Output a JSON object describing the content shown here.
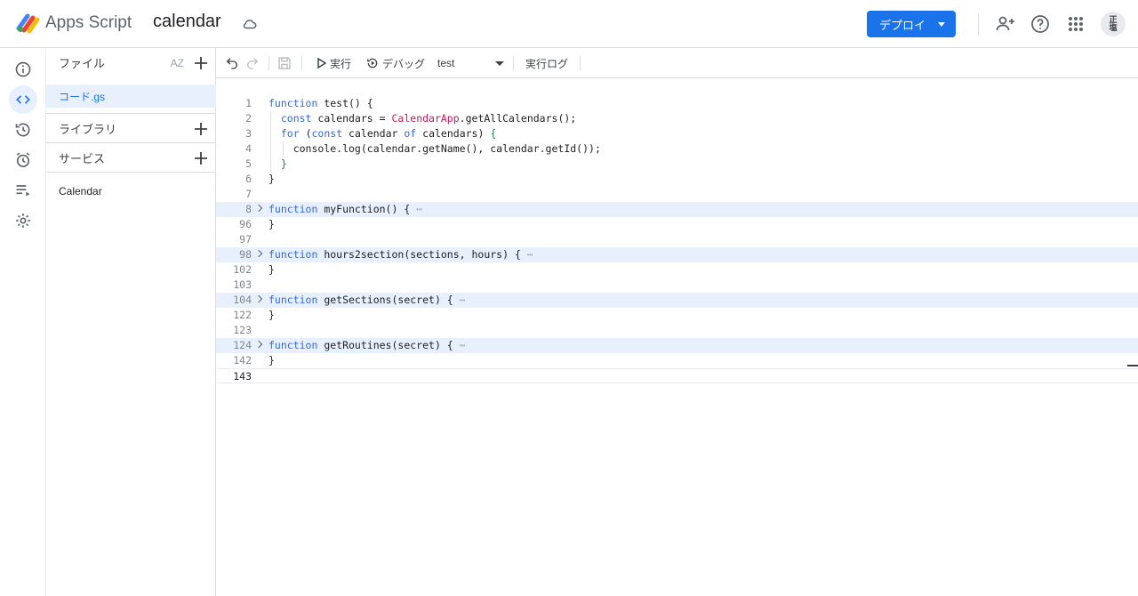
{
  "header": {
    "product_name": "Apps Script",
    "project_name": "calendar",
    "deploy_label": "デプロイ",
    "avatar_line1": "正",
    "avatar_line2": "塩"
  },
  "rail": {
    "items": [
      "overview",
      "editor",
      "executions",
      "triggers",
      "project-settings-logs",
      "settings"
    ],
    "active": "editor"
  },
  "files_panel": {
    "files_title": "ファイル",
    "sort_label": "AZ",
    "files": [
      "コード.gs"
    ],
    "libraries_title": "ライブラリ",
    "services_title": "サービス",
    "services": [
      "Calendar"
    ]
  },
  "toolbar": {
    "run_label": "実行",
    "debug_label": "デバッグ",
    "function_select": "test",
    "log_label": "実行ログ"
  },
  "code": {
    "lines": [
      {
        "n": "1",
        "html": "<span class=\"kw\">function</span> test() {"
      },
      {
        "n": "2",
        "html": "  <span class=\"kw\">const</span> calendars = <span class=\"cls\">CalendarApp</span>.getAllCalendars();"
      },
      {
        "n": "3",
        "html": "  <span class=\"kw\">for</span> (<span class=\"kw\">const</span> calendar <span class=\"kw\">of</span> calendars) <span class=\"punc\">{</span>"
      },
      {
        "n": "4",
        "html": "    console.log(calendar.getName(), calendar.getId());"
      },
      {
        "n": "5",
        "html": "  <span class=\"punc\">}</span>"
      },
      {
        "n": "6",
        "html": "}"
      },
      {
        "n": "7",
        "html": ""
      },
      {
        "n": "8",
        "html": "<span class=\"kw\">function</span> myFunction() { <span class=\"ell\">⋯</span>",
        "folded": true
      },
      {
        "n": "96",
        "html": "}"
      },
      {
        "n": "97",
        "html": ""
      },
      {
        "n": "98",
        "html": "<span class=\"kw\">function</span> hours2section(sections, hours) { <span class=\"ell\">⋯</span>",
        "folded": true
      },
      {
        "n": "102",
        "html": "}"
      },
      {
        "n": "103",
        "html": ""
      },
      {
        "n": "104",
        "html": "<span class=\"kw\">function</span> getSections(secret) { <span class=\"ell\">⋯</span>",
        "folded": true
      },
      {
        "n": "122",
        "html": "}"
      },
      {
        "n": "123",
        "html": ""
      },
      {
        "n": "124",
        "html": "<span class=\"kw\">function</span> getRoutines(secret) { <span class=\"ell\">⋯</span>",
        "folded": true
      },
      {
        "n": "142",
        "html": "}"
      },
      {
        "n": "143",
        "html": "",
        "current": true
      }
    ]
  },
  "colors": {
    "accent": "#1a73e8",
    "keyword": "#3367d6",
    "class_name": "#c2185b",
    "fold_highlight": "#e8f0fe"
  }
}
